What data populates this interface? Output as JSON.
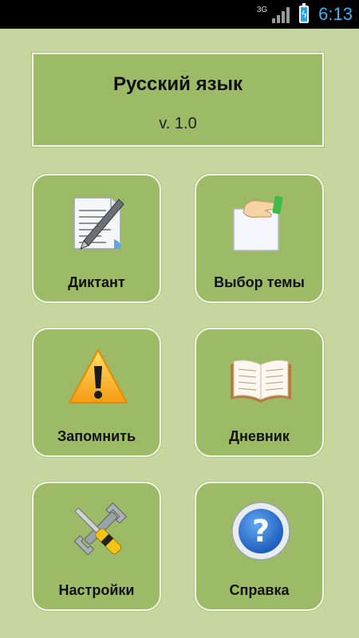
{
  "status_bar": {
    "network": "3G",
    "time": "6:13"
  },
  "header": {
    "title": "Русский язык",
    "version": "v. 1.0"
  },
  "menu": [
    {
      "label": "Диктант",
      "icon": "document-pen-icon"
    },
    {
      "label": "Выбор темы",
      "icon": "hand-paper-icon"
    },
    {
      "label": "Запомнить",
      "icon": "warning-icon"
    },
    {
      "label": "Дневник",
      "icon": "open-book-icon"
    },
    {
      "label": "Настройки",
      "icon": "wrench-screwdriver-icon"
    },
    {
      "label": "Справка",
      "icon": "help-question-icon"
    }
  ],
  "colors": {
    "background": "#c6d69e",
    "tile": "#9dba67",
    "clock": "#3db4ec"
  }
}
